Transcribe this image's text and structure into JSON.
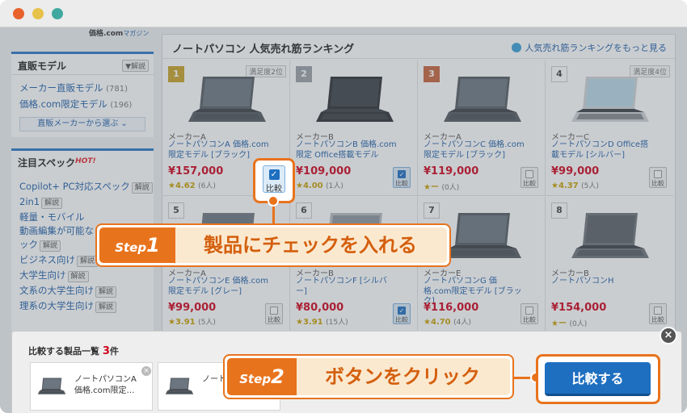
{
  "window": {
    "dots": [
      "#e8622c",
      "#e6c24a",
      "#3fa9a0"
    ]
  },
  "sidebar": {
    "logo": "価格.com",
    "logo_sub": "マガジン",
    "direct": {
      "title": "直販モデル",
      "help": "▼解説",
      "links": [
        {
          "label": "メーカー直販モデル",
          "count": "(781)"
        },
        {
          "label": "価格.com限定モデル",
          "count": "(196)"
        }
      ],
      "dropdown": "直販メーカーから選ぶ ⌄"
    },
    "spec": {
      "title": "注目スペック",
      "hot": "HOT!",
      "items": [
        {
          "label": "Copilot+ PC対応スペック",
          "tag": "解説"
        },
        {
          "label": "2in1",
          "tag": "解説"
        },
        {
          "label": "軽量・モバイル",
          "tag": ""
        },
        {
          "label": "動画編集が可能な",
          "tag": ""
        },
        {
          "label": "ック",
          "tag": "解説"
        },
        {
          "label": "ビジネス向け",
          "tag": "解説"
        },
        {
          "label": "大学生向け",
          "tag": "解説"
        },
        {
          "label": "文系の大学生向け",
          "tag": "解説"
        },
        {
          "label": "理系の大学生向け",
          "tag": "解説"
        }
      ]
    }
  },
  "ranking": {
    "title": "ノートパソコン 人気売れ筋ランキング",
    "more": "人気売れ筋ランキングをもっと見る",
    "compare_label": "比較",
    "products": [
      {
        "rank": "1",
        "badge": "満足度2位",
        "maker": "メーカーA",
        "name": "ノートパソコンA 価格.com限定モデル [ブラック]",
        "price": "¥157,000",
        "rating": "4.62",
        "reviews": "(6人)",
        "checked": true,
        "rank_color": "#c9a227",
        "screen": "#6c7680",
        "body": "#555b61"
      },
      {
        "rank": "2",
        "badge": "",
        "maker": "メーカーB",
        "name": "ノートパソコンB 価格.com限定 Office搭載モデル",
        "price": "¥109,000",
        "rating": "4.00",
        "reviews": "(1人)",
        "checked": true,
        "rank_color": "#9aa0a6",
        "screen": "#3d4249",
        "body": "#2b2f33"
      },
      {
        "rank": "3",
        "badge": "",
        "maker": "メーカーA",
        "name": "ノートパソコンC 価格.com限定モデル [ブラック]",
        "price": "¥119,000",
        "rating": "ー",
        "reviews": "(0人)",
        "checked": false,
        "rank_color": "#c8643b",
        "screen": "#6c7680",
        "body": "#555b61"
      },
      {
        "rank": "4",
        "badge": "満足度4位",
        "maker": "メーカーC",
        "name": "ノートパソコンD Office搭載モデル [シルバー]",
        "price": "¥99,000",
        "rating": "4.37",
        "reviews": "(5人)",
        "checked": false,
        "rank_color": "",
        "screen": "#b9d7e8",
        "body": "#cfd3d6"
      },
      {
        "rank": "5",
        "badge": "",
        "maker": "メーカーA",
        "name": "ノートパソコンE 価格.com限定モデル [グレー]",
        "price": "¥99,000",
        "rating": "3.91",
        "reviews": "(5人)",
        "checked": false,
        "rank_color": "",
        "screen": "#6c7680",
        "body": "#707780"
      },
      {
        "rank": "6",
        "badge": "",
        "maker": "メーカーB",
        "name": "ノートパソコンF [シルバー]",
        "price": "¥80,000",
        "rating": "3.91",
        "reviews": "(15人)",
        "checked": true,
        "rank_color": "",
        "screen": "#8d959c",
        "body": "#b8bcc0"
      },
      {
        "rank": "7",
        "badge": "",
        "maker": "メーカーE",
        "name": "ノートパソコンG 価格.com限定モデル [ブラック]",
        "price": "¥116,000",
        "rating": "4.70",
        "reviews": "(4人)",
        "checked": false,
        "rank_color": "",
        "screen": "#6c7680",
        "body": "#555b61"
      },
      {
        "rank": "8",
        "badge": "",
        "maker": "メーカーB",
        "name": "ノートパソコンH",
        "price": "¥154,000",
        "rating": "ー",
        "reviews": "(0人)",
        "checked": false,
        "rank_color": "",
        "screen": "#5a6068",
        "body": "#6e747a"
      }
    ]
  },
  "steps": {
    "step1": {
      "prefix": "Step",
      "num": "1",
      "text": "製品にチェックを入れる"
    },
    "step2": {
      "prefix": "Step",
      "num": "2",
      "text": "ボタンをクリック"
    }
  },
  "tray": {
    "title": "比較する製品一覧",
    "count": "3",
    "unit": "件",
    "items": [
      {
        "line1": "ノートパソコンA",
        "line2": "価格.com限定…"
      },
      {
        "line1": "ノート",
        "line2": ""
      }
    ],
    "close": "×",
    "item_remove": "×",
    "compare_button": "比較する"
  },
  "highlight": {
    "check_label": "比較"
  },
  "colors": {
    "accent": "#e8731d",
    "link": "#1e5fa8",
    "price": "#d0021b",
    "button": "#1e6fc0"
  }
}
